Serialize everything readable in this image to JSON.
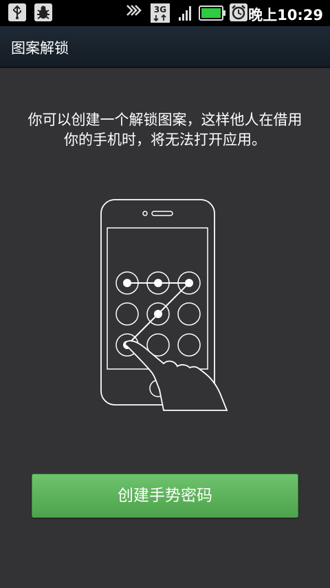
{
  "status_bar": {
    "network_label": "3G",
    "clock": "晚上10:29",
    "icons": [
      "usb-icon",
      "debug-bug-icon",
      "sync-arrows-icon",
      "3g-data-icon",
      "signal-strength-icon",
      "battery-icon",
      "alarm-clock-icon"
    ],
    "battery_color": "#2ecc40"
  },
  "header": {
    "title": "图案解锁"
  },
  "main": {
    "instruction": "你可以创建一个解锁图案，这样他人在借用你的手机时，将无法打开应用。",
    "illustration": {
      "icons": [
        "phone-outline-icon",
        "pattern-grid-icon",
        "hand-icon"
      ]
    },
    "create_button_label": "创建手势密码"
  },
  "colors": {
    "background": "#333336",
    "title_bar": "#1a232d",
    "button": "#5cb55a"
  }
}
